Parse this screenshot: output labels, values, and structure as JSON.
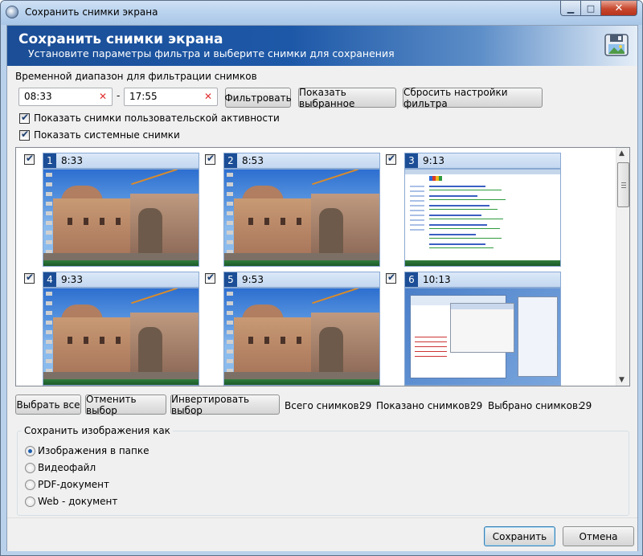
{
  "window": {
    "title": "Сохранить снимки экрана"
  },
  "banner": {
    "title": "Сохранить снимки экрана",
    "subtitle": "Установите параметры фильтра и выберите снимки для сохранения"
  },
  "filter": {
    "range_label": "Временной диапазон для фильтрации снимков",
    "from_value": "08:33",
    "separator": "-",
    "to_value": "17:55",
    "clear_glyph": "✕",
    "filter_button": "Фильтровать",
    "show_selected_button": "Показать выбранное",
    "reset_button": "Сбросить настройки фильтра",
    "show_user_activity": {
      "label": "Показать снимки пользовательской активности",
      "checked": true
    },
    "show_system": {
      "label": "Показать системные снимки",
      "checked": true
    }
  },
  "screenshots": [
    {
      "num": "1",
      "time": "8:33",
      "checked": true,
      "kind": "photo"
    },
    {
      "num": "2",
      "time": "8:53",
      "checked": true,
      "kind": "photo"
    },
    {
      "num": "3",
      "time": "9:13",
      "checked": true,
      "kind": "browser"
    },
    {
      "num": "4",
      "time": "9:33",
      "checked": true,
      "kind": "photo"
    },
    {
      "num": "5",
      "time": "9:53",
      "checked": true,
      "kind": "photo"
    },
    {
      "num": "6",
      "time": "10:13",
      "checked": true,
      "kind": "office"
    }
  ],
  "selection": {
    "select_all": "Выбрать все",
    "deselect": "Отменить выбор",
    "invert": "Инвертировать выбор",
    "total_label": "Всего снимков:",
    "total_value": "29",
    "shown_label": "Показано снимков:",
    "shown_value": "29",
    "selected_label": "Выбрано снимков:",
    "selected_value": "29"
  },
  "save_as": {
    "title": "Сохранить изображения как",
    "options": [
      {
        "label": "Изображения в папке",
        "selected": true
      },
      {
        "label": "Видеофайл",
        "selected": false
      },
      {
        "label": "PDF-документ",
        "selected": false
      },
      {
        "label": "Web - документ",
        "selected": false
      }
    ]
  },
  "footer": {
    "save_button": "Сохранить",
    "cancel_button": "Отмена"
  },
  "colors": {
    "accent": "#1b4e96",
    "header_fill": "#c2d7f0",
    "clear_x": "#e03030"
  },
  "icons": {
    "app": "app-icon",
    "save_disk": "save-disk-icon",
    "checkbox_tick": "✔"
  }
}
